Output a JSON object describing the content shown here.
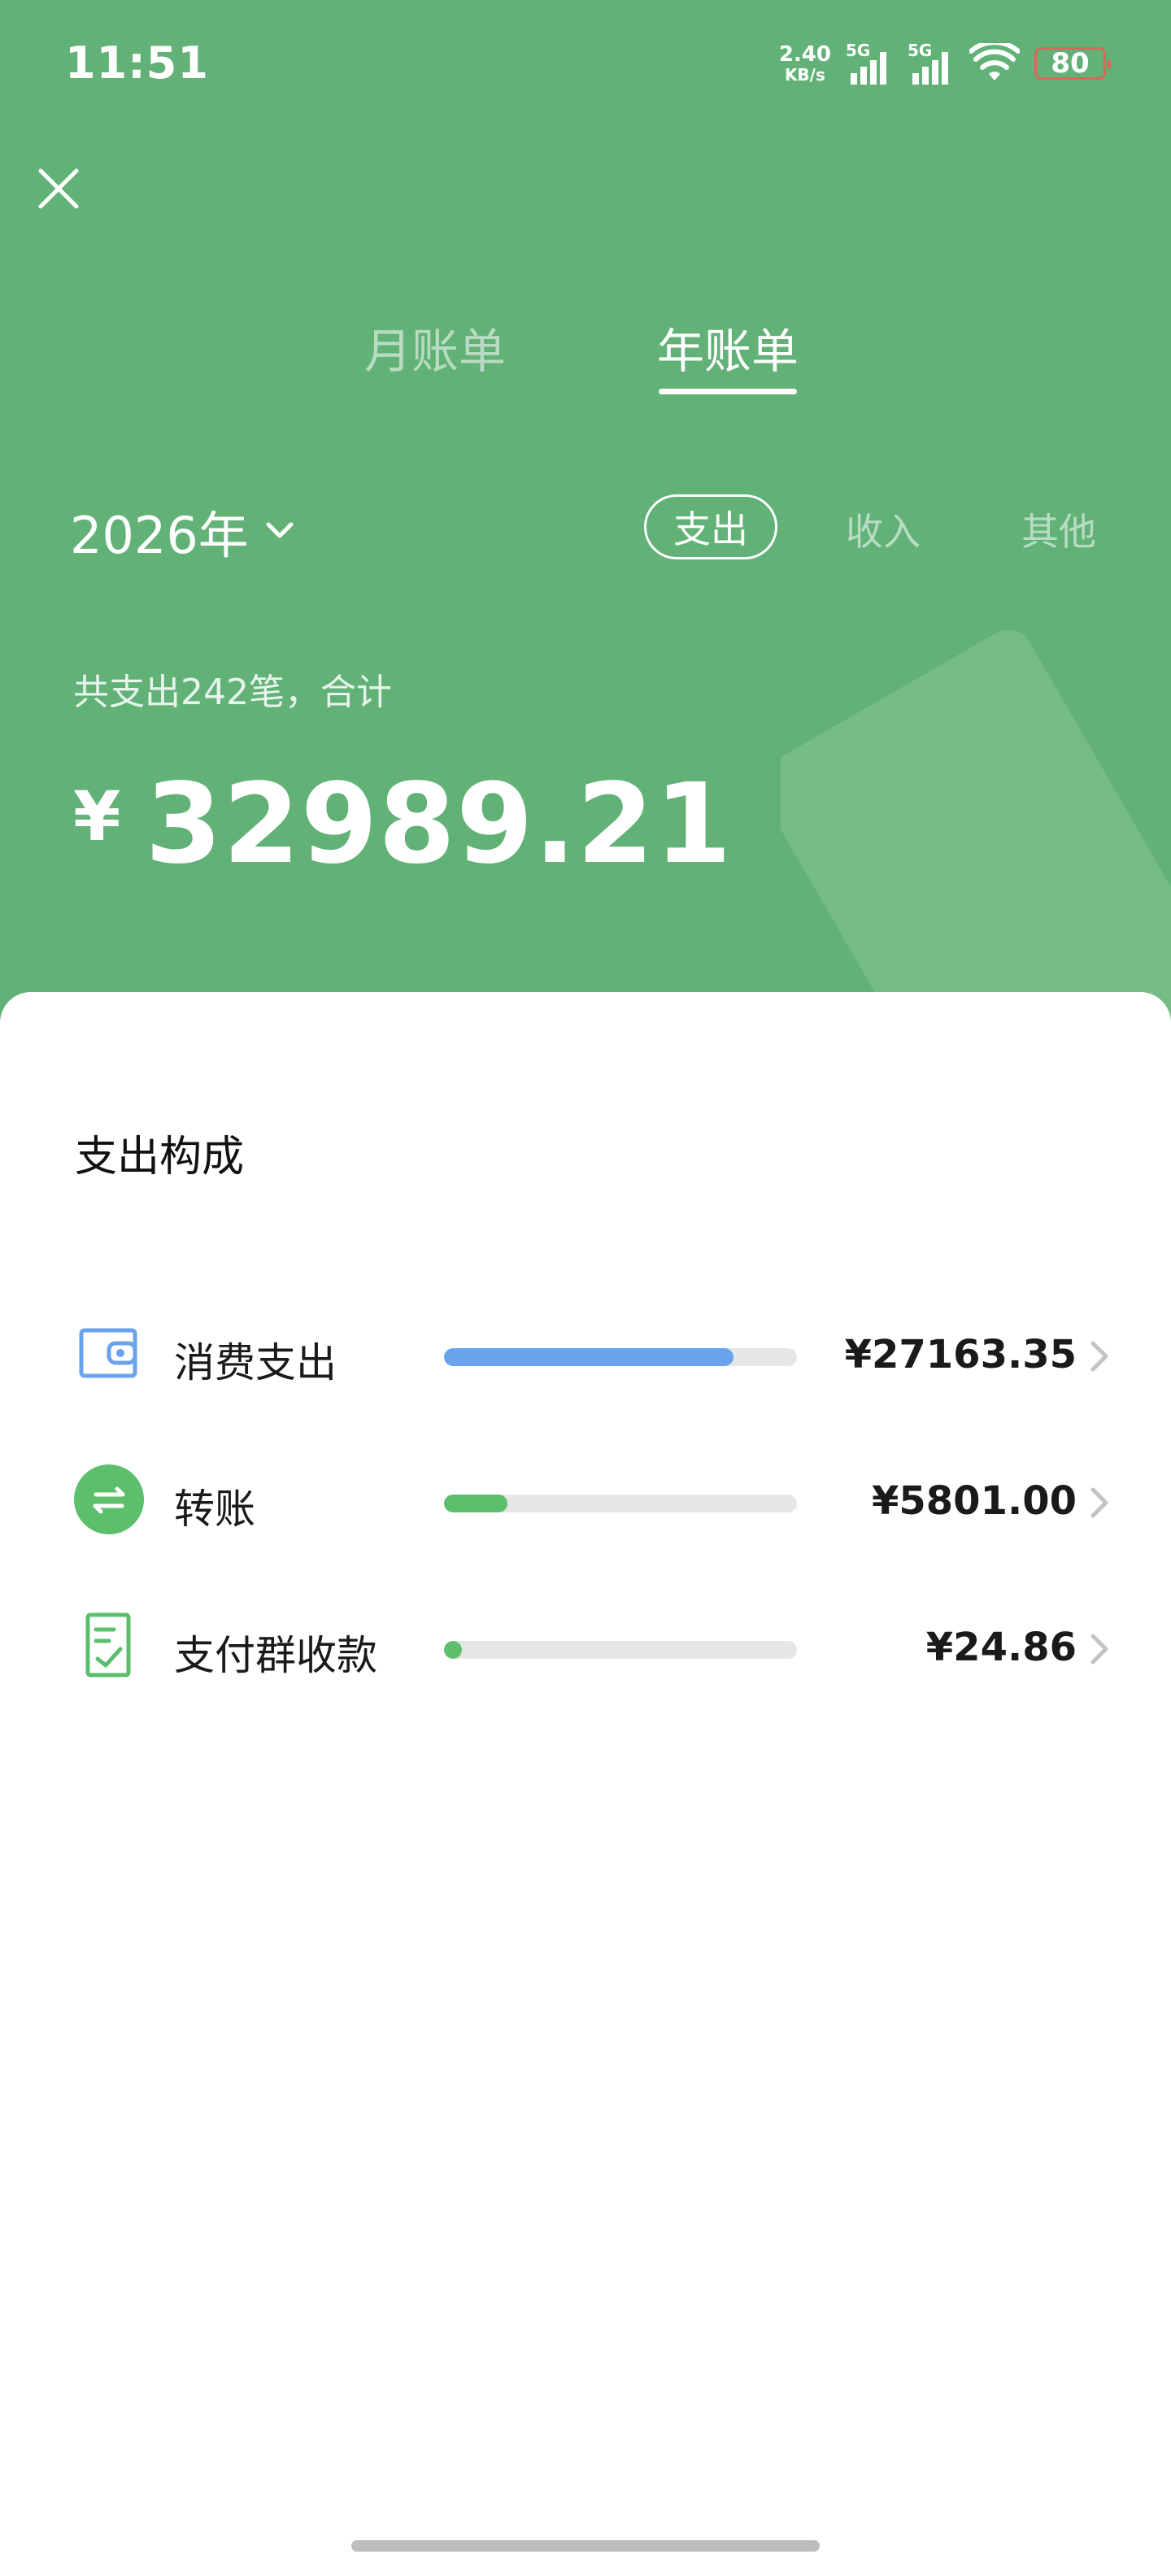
{
  "status_bar": {
    "time": "11:51",
    "net_speed_value": "2.40",
    "net_speed_unit": "KB/s",
    "signal1": "5G",
    "signal2": "5G",
    "battery": "80"
  },
  "tabs": [
    {
      "label": "月账单",
      "active": false
    },
    {
      "label": "年账单",
      "active": true
    }
  ],
  "year_selector": {
    "label": "2026年"
  },
  "filters": [
    {
      "label": "支出",
      "selected": true
    },
    {
      "label": "收入",
      "selected": false
    },
    {
      "label": "其他",
      "selected": false
    }
  ],
  "summary": {
    "text": "共支出242笔，合计",
    "currency": "¥",
    "total": "32989.21"
  },
  "breakdown": {
    "title": "支出构成",
    "items": [
      {
        "name": "消费支出",
        "amount": "¥27163.35",
        "ratio": 0.82,
        "color": "#6aa3ec",
        "icon": "wallet-icon"
      },
      {
        "name": "转账",
        "amount": "¥5801.00",
        "ratio": 0.18,
        "color": "#5cbf6c",
        "icon": "transfer-icon"
      },
      {
        "name": "支付群收款",
        "amount": "¥24.86",
        "ratio": 0.05,
        "color": "#5cbf6c",
        "icon": "receipt-icon"
      }
    ]
  },
  "colors": {
    "header_green": "#62b278",
    "consumption_blue": "#6aa3ec",
    "transfer_green": "#5cbf6c"
  }
}
